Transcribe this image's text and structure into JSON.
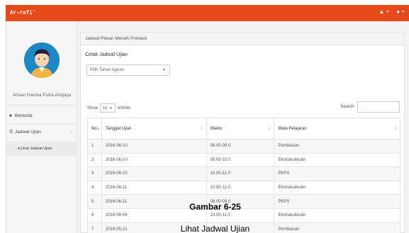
{
  "app": {
    "brand": "Ar-rafi'",
    "top_icons": [
      "bell-icon",
      "user-icon"
    ],
    "accent_color": "#e64a19"
  },
  "sidebar": {
    "user_name": "Ahsan Hamka Putra Amijaya",
    "items": [
      {
        "label": "Beranda",
        "icon": "home-icon"
      },
      {
        "label": "Jadwal Ujian",
        "icon": "list-icon"
      }
    ],
    "sub_items": [
      {
        "label": "Lihat Jadwal Ujian",
        "icon": "circle-icon"
      }
    ]
  },
  "panel": {
    "title": "Jadwal Pekan Meraih Prestasi",
    "cetak_label": "Cetak Jadwal Ujian",
    "tahun_select": "Pilih Tahun Ajaran"
  },
  "table_controls": {
    "show_label": "Show",
    "entries_value": "10",
    "entries_label": "entries",
    "search_label": "Search:"
  },
  "table": {
    "columns": [
      "No",
      "Tanggal Ujian",
      "Waktu",
      "Mata Pelajaran"
    ],
    "rows": [
      [
        "1",
        "2016-06-10",
        "08.00-09.0",
        "Pembiasan"
      ],
      [
        "2",
        "2016-06-10",
        "09.00-10.0",
        "Ekstrakulikuler"
      ],
      [
        "3",
        "2016-06-10",
        "10.00-11.0",
        "PKPS"
      ],
      [
        "4",
        "2016-06-11",
        "10.00-11.0",
        "Ekstrakulikuler"
      ],
      [
        "5",
        "2016-06-11",
        "08.00-09.0",
        "PKPS"
      ],
      [
        "6",
        "2016-06-04",
        "10.00-11.0",
        "Ekstrakulikuler"
      ],
      [
        "7",
        "2016-05-21",
        "",
        "Pembiasan"
      ]
    ]
  },
  "caption": {
    "figure": "Gambar 6-25",
    "title": "Lihat Jadwal Ujian"
  }
}
